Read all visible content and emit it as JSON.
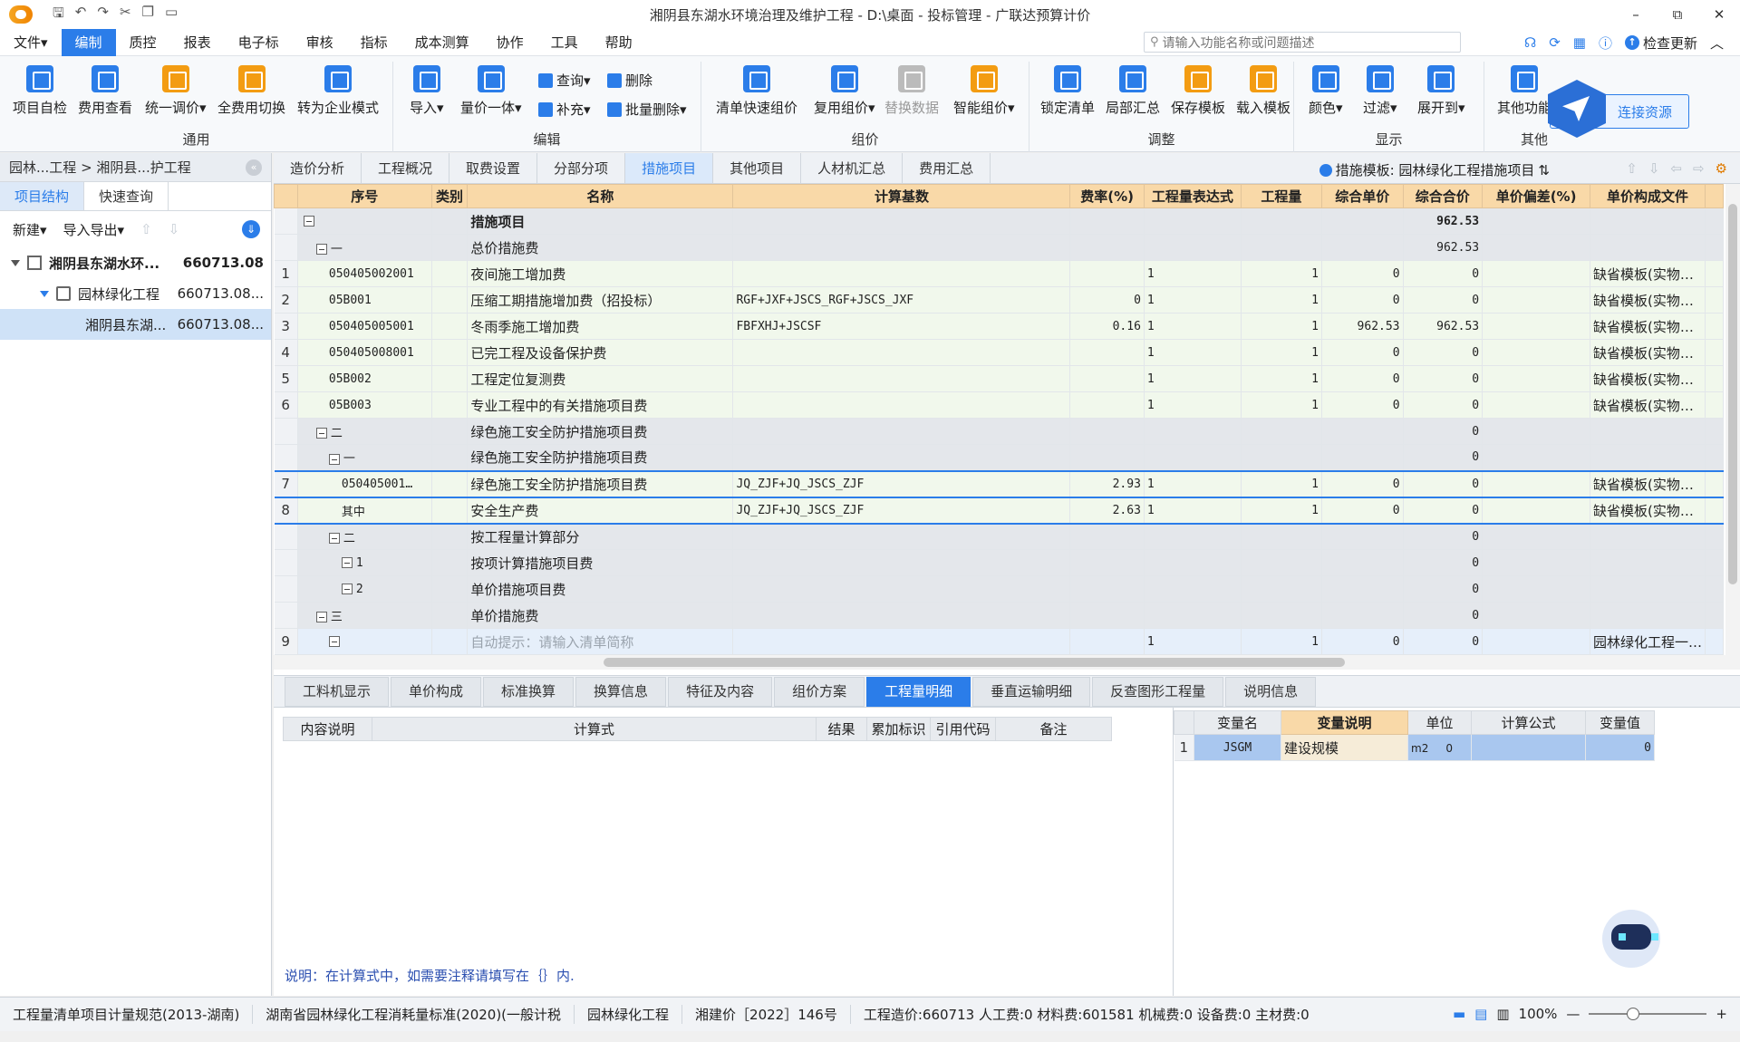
{
  "window": {
    "title": "湘阴县东湖水环境治理及维护工程 - D:\\桌面 - 投标管理 - 广联达预算计价",
    "min": "–",
    "max": "⧉",
    "close": "✕"
  },
  "menu": {
    "items": [
      "文件▾",
      "编制",
      "质控",
      "报表",
      "电子标",
      "审核",
      "指标",
      "成本测算",
      "协作",
      "工具",
      "帮助"
    ],
    "search_placeholder": "请输入功能名称或问题描述",
    "check_update": "检查更新"
  },
  "ribbon": {
    "general": {
      "label": "通用",
      "buttons": [
        "项目自检",
        "费用查看",
        "统一调价▾",
        "全费用切换",
        "转为企业模式"
      ]
    },
    "edit": {
      "label": "编辑",
      "buttons": [
        "导入▾",
        "量价一体▾"
      ],
      "small": [
        "查询▾",
        "删除",
        "补充▾",
        "批量删除▾"
      ]
    },
    "price": {
      "label": "组价",
      "buttons": [
        "清单快速组价",
        "复用组价▾",
        "替换数据",
        "智能组价▾"
      ]
    },
    "adjust": {
      "label": "调整",
      "buttons": [
        "锁定清单",
        "局部汇总",
        "保存模板",
        "载入模板"
      ]
    },
    "display": {
      "label": "显示",
      "buttons": [
        "颜色▾",
        "过滤▾",
        "展开到▾"
      ]
    },
    "other": {
      "label": "其他",
      "buttons": [
        "其他功能"
      ]
    },
    "connect": "连接资源"
  },
  "left": {
    "breadcrumb": "园林...工程 > 湘阴县...护工程",
    "tabs": [
      "项目结构",
      "快速查询"
    ],
    "tools": [
      "新建▾",
      "导入导出▾"
    ],
    "tree": [
      {
        "name": "湘阴县东湖水环...",
        "value": "660713.08"
      },
      {
        "name": "园林绿化工程",
        "value": "660713.08..."
      },
      {
        "name": "湘阴县东湖...",
        "value": "660713.08..."
      }
    ]
  },
  "main": {
    "tabs": [
      "造价分析",
      "工程概况",
      "取费设置",
      "分部分项",
      "措施项目",
      "其他项目",
      "人材机汇总",
      "费用汇总"
    ],
    "template": "措施模板: 园林绿化工程措施项目",
    "columns": [
      "序号",
      "类别",
      "名称",
      "计算基数",
      "费率(%)",
      "工程量表达式",
      "工程量",
      "综合单价",
      "综合合价",
      "单价偏差(%)",
      "单价构成文件"
    ],
    "rows": [
      {
        "rn": "",
        "code": "",
        "name": "措施项目",
        "base": "",
        "rate": "",
        "expr": "",
        "qty": "",
        "up": "",
        "total": "962.53",
        "dev": "",
        "file": "",
        "style": "gray",
        "bold": true,
        "indent": 0
      },
      {
        "rn": "",
        "code": "一",
        "name": "总价措施费",
        "base": "",
        "rate": "",
        "expr": "",
        "qty": "",
        "up": "",
        "total": "962.53",
        "dev": "",
        "file": "",
        "style": "gray",
        "indent": 1
      },
      {
        "rn": "1",
        "code": "050405002001",
        "name": "夜间施工增加费",
        "base": "",
        "rate": "",
        "expr": "1",
        "qty": "1",
        "up": "0",
        "total": "0",
        "dev": "",
        "file": "缺省模板(实物…",
        "style": "grn",
        "indent": 2
      },
      {
        "rn": "2",
        "code": "05B001",
        "name": "压缩工期措施增加费（招投标）",
        "base": "RGF+JXF+JSCS_RGF+JSCS_JXF",
        "rate": "0",
        "expr": "1",
        "qty": "1",
        "up": "0",
        "total": "0",
        "dev": "",
        "file": "缺省模板(实物…",
        "style": "grn",
        "indent": 2
      },
      {
        "rn": "3",
        "code": "050405005001",
        "name": "冬雨季施工增加费",
        "base": "FBFXHJ+JSCSF",
        "rate": "0.16",
        "expr": "1",
        "qty": "1",
        "up": "962.53",
        "total": "962.53",
        "dev": "",
        "file": "缺省模板(实物…",
        "style": "grn",
        "indent": 2
      },
      {
        "rn": "4",
        "code": "050405008001",
        "name": "已完工程及设备保护费",
        "base": "",
        "rate": "",
        "expr": "1",
        "qty": "1",
        "up": "0",
        "total": "0",
        "dev": "",
        "file": "缺省模板(实物…",
        "style": "grn",
        "indent": 2
      },
      {
        "rn": "5",
        "code": "05B002",
        "name": "工程定位复测费",
        "base": "",
        "rate": "",
        "expr": "1",
        "qty": "1",
        "up": "0",
        "total": "0",
        "dev": "",
        "file": "缺省模板(实物…",
        "style": "grn",
        "indent": 2
      },
      {
        "rn": "6",
        "code": "05B003",
        "name": "专业工程中的有关措施项目费",
        "base": "",
        "rate": "",
        "expr": "1",
        "qty": "1",
        "up": "0",
        "total": "0",
        "dev": "",
        "file": "缺省模板(实物…",
        "style": "grn",
        "indent": 2
      },
      {
        "rn": "",
        "code": "二",
        "name": "绿色施工安全防护措施项目费",
        "base": "",
        "rate": "",
        "expr": "",
        "qty": "",
        "up": "",
        "total": "0",
        "dev": "",
        "file": "",
        "style": "gray",
        "indent": 1
      },
      {
        "rn": "",
        "code": "一",
        "name": "绿色施工安全防护措施项目费",
        "base": "",
        "rate": "",
        "expr": "",
        "qty": "",
        "up": "",
        "total": "0",
        "dev": "",
        "file": "",
        "style": "gray",
        "indent": 2
      },
      {
        "rn": "7",
        "code": "050405001…",
        "name": "绿色施工安全防护措施项目费",
        "base": "JQ_ZJF+JQ_JSCS_ZJF",
        "rate": "2.93",
        "expr": "1",
        "qty": "1",
        "up": "0",
        "total": "0",
        "dev": "",
        "file": "缺省模板(实物…",
        "style": "sel",
        "indent": 3
      },
      {
        "rn": "8",
        "code": "其中",
        "name": "安全生产费",
        "base": "JQ_ZJF+JQ_JSCS_ZJF",
        "rate": "2.63",
        "expr": "1",
        "qty": "1",
        "up": "0",
        "total": "0",
        "dev": "",
        "file": "缺省模板(实物…",
        "style": "sel",
        "indent": 3
      },
      {
        "rn": "",
        "code": "二",
        "name": "按工程量计算部分",
        "base": "",
        "rate": "",
        "expr": "",
        "qty": "",
        "up": "",
        "total": "0",
        "dev": "",
        "file": "",
        "style": "gray",
        "indent": 2
      },
      {
        "rn": "",
        "code": "1",
        "name": "按项计算措施项目费",
        "base": "",
        "rate": "",
        "expr": "",
        "qty": "",
        "up": "",
        "total": "0",
        "dev": "",
        "file": "",
        "style": "gray",
        "indent": 3
      },
      {
        "rn": "",
        "code": "2",
        "name": "单价措施项目费",
        "base": "",
        "rate": "",
        "expr": "",
        "qty": "",
        "up": "",
        "total": "0",
        "dev": "",
        "file": "",
        "style": "gray",
        "indent": 3
      },
      {
        "rn": "",
        "code": "三",
        "name": "单价措施费",
        "base": "",
        "rate": "",
        "expr": "",
        "qty": "",
        "up": "",
        "total": "0",
        "dev": "",
        "file": "",
        "style": "gray",
        "indent": 1
      },
      {
        "rn": "9",
        "code": "",
        "name": "自动提示：请输入清单简称",
        "base": "",
        "rate": "",
        "expr": "1",
        "qty": "1",
        "up": "0",
        "total": "0",
        "dev": "",
        "file": "园林绿化工程一…",
        "style": "auto",
        "indent": 2,
        "hint": true
      }
    ]
  },
  "bottom": {
    "tabs": [
      "工料机显示",
      "单价构成",
      "标准换算",
      "换算信息",
      "特征及内容",
      "组价方案",
      "工程量明细",
      "垂直运输明细",
      "反查图形工程量",
      "说明信息"
    ],
    "left_columns": [
      "内容说明",
      "计算式",
      "结果",
      "累加标识",
      "引用代码",
      "备注"
    ],
    "right_columns": [
      "变量名",
      "变量说明",
      "单位",
      "计算公式",
      "变量值"
    ],
    "right_row": {
      "rn": "1",
      "var": "JSGM",
      "desc": "建设规模",
      "unit": "m2",
      "formula": "0",
      "value": "0"
    },
    "note": "说明：在计算式中，如需要注释请填写在｛｝内."
  },
  "status": {
    "items": [
      "工程量清单项目计量规范(2013-湖南)",
      "湖南省园林绿化工程消耗量标准(2020)(一般计税",
      "园林绿化工程",
      "湘建价［2022］146号",
      "工程造价:660713  人工费:0  材料费:601581  机械费:0  设备费:0  主材费:0"
    ],
    "zoom": "100%"
  }
}
